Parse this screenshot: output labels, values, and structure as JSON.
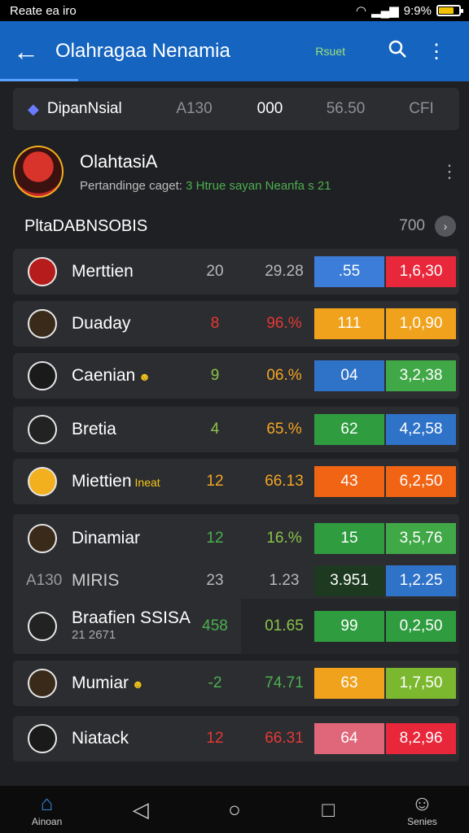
{
  "status_bar": {
    "left_text": "Reate ea iro",
    "time_battery": "9:9%"
  },
  "app_bar": {
    "title": "Olahragaa Nenamia",
    "small_text": "Rsuet",
    "icons": [
      "back-arrow-icon",
      "search-icon",
      "more-vert-icon"
    ]
  },
  "tabs": [
    {
      "label": "DipanNsial"
    },
    {
      "label": "A130"
    },
    {
      "label": "000"
    },
    {
      "label": "56.50"
    },
    {
      "label": "CFI"
    }
  ],
  "club": {
    "name": "OlahtasiA",
    "subtitle": "Pertandinge caget:",
    "subtitle_green": " 3 Htrue sayan Neanfa s 21"
  },
  "section": {
    "label": "PltaDABNSOBIS",
    "count": "700"
  },
  "rows": [
    {
      "name": "Merttien",
      "tag": "",
      "v1": "20",
      "v2": "29.28",
      "b1": ".55",
      "b2": "1,6,30",
      "v1_color": "grey",
      "v2_color": "grey",
      "b1_color": "#3b7dd8",
      "b2_color": "#e8273a"
    },
    {
      "name": "Duaday",
      "tag": "",
      "v1": "8",
      "v2": "96.%",
      "b1": "111",
      "b2": "1,0,90",
      "v1_color": "red",
      "v2_color": "red",
      "b1_color": "#f0a21d",
      "b2_color": "#f0a21d"
    },
    {
      "name": "Caenian",
      "tag": "☻",
      "v1": "9",
      "v2": "06.%",
      "b1": "04",
      "b2": "3,2,38",
      "v1_color": "lgreen",
      "v2_color": "orange",
      "b1_color": "#2f73c9",
      "b2_color": "#41a848"
    },
    {
      "name": "Bretia",
      "tag": "",
      "v1": "4",
      "v2": "65.%",
      "b1": "62",
      "b2": "4,2,58",
      "v1_color": "lgreen",
      "v2_color": "orange",
      "b1_color": "#2e9c3f",
      "b2_color": "#2f73c9"
    },
    {
      "name": "Miettien",
      "tag": "Ineat",
      "v1": "12",
      "v2": "66.13",
      "b1": "43",
      "b2": "6,2,50",
      "v1_color": "orange",
      "v2_color": "orange",
      "b1_color": "#f06414",
      "b2_color": "#f06414"
    }
  ],
  "group": [
    {
      "name": "Dinamiar",
      "v1": "12",
      "v2": "16.%",
      "b1": "15",
      "b2": "3,5,76",
      "v1_color": "green",
      "v2_color": "lgreen",
      "b1_color": "#2e9c3f",
      "b2_color": "#41a848"
    },
    {
      "left_label": "A130",
      "name": "MIRIS",
      "v1": "23",
      "v2": "1.23",
      "b1": "3.951",
      "b2": "1,2.25",
      "v1_color": "grey",
      "v2_color": "grey",
      "b1_color": "#1d3a20",
      "b2_color": "#2f73c9"
    },
    {
      "name": "Braafien SSISA",
      "sub": "21 2671",
      "v1": "458",
      "v2": "01.65",
      "b1": "99",
      "b2": "0,2,50",
      "v1_color": "green",
      "v2_color": "lgreen",
      "b1_color": "#2e9c3f",
      "b2_color": "#2e9c3f"
    }
  ],
  "rows2": [
    {
      "name": "Mumiar",
      "tag": "☻",
      "v1": "-2",
      "v2": "74.71",
      "b1": "63",
      "b2": "1,7,50",
      "v1_color": "green",
      "v2_color": "green",
      "b1_color": "#f0a21d",
      "b2_color": "#7cb82f"
    },
    {
      "name": "Niatack",
      "tag": "",
      "v1": "12",
      "v2": "66.31",
      "b1": "64",
      "b2": "8,2,96",
      "v1_color": "red",
      "v2_color": "red",
      "b1_color": "#e0667a",
      "b2_color": "#e8273a"
    }
  ],
  "bottom_nav": [
    {
      "label": "Ainoan",
      "icon": "home-icon"
    },
    {
      "label": "",
      "icon": "back-triangle-icon"
    },
    {
      "label": "",
      "icon": "home-circle-icon"
    },
    {
      "label": "",
      "icon": "recents-square-icon"
    },
    {
      "label": "Senies",
      "icon": "person-icon"
    }
  ]
}
